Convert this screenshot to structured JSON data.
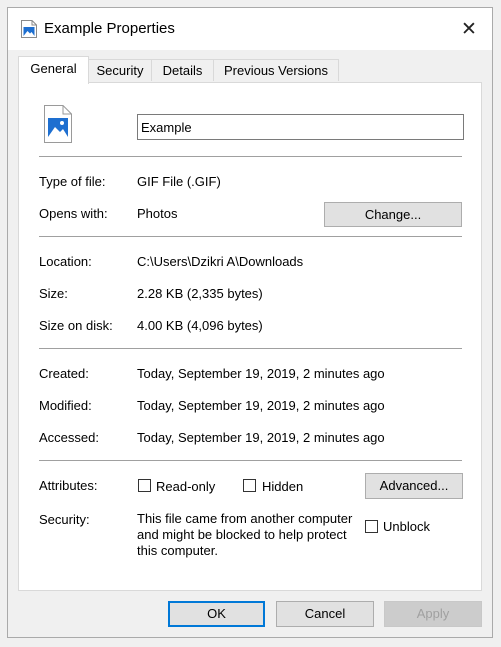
{
  "window": {
    "title": "Example Properties",
    "close_glyph": "✕"
  },
  "tabs": [
    {
      "label": "General",
      "active": true
    },
    {
      "label": "Security",
      "active": false
    },
    {
      "label": "Details",
      "active": false
    },
    {
      "label": "Previous Versions",
      "active": false
    }
  ],
  "file": {
    "icon": "image-file-icon",
    "name": "Example"
  },
  "type_of_file": {
    "label": "Type of file:",
    "value": "GIF File (.GIF)"
  },
  "opens_with": {
    "label": "Opens with:",
    "value": "Photos",
    "button": "Change..."
  },
  "location": {
    "label": "Location:",
    "value": "C:\\Users\\Dzikri A\\Downloads"
  },
  "size": {
    "label": "Size:",
    "value": "2.28 KB (2,335 bytes)"
  },
  "size_on_disk": {
    "label": "Size on disk:",
    "value": "4.00 KB (4,096 bytes)"
  },
  "created": {
    "label": "Created:",
    "value": "Today, September 19, 2019, 2 minutes ago"
  },
  "modified": {
    "label": "Modified:",
    "value": "Today, September 19, 2019, 2 minutes ago"
  },
  "accessed": {
    "label": "Accessed:",
    "value": "Today, September 19, 2019, 2 minutes ago"
  },
  "attributes": {
    "label": "Attributes:",
    "read_only": {
      "label": "Read-only",
      "checked": false
    },
    "hidden": {
      "label": "Hidden",
      "checked": false
    },
    "advanced_button": "Advanced..."
  },
  "security": {
    "label": "Security:",
    "text": "This file came from another computer and might be blocked to help protect this computer.",
    "unblock": {
      "label": "Unblock",
      "checked": false
    }
  },
  "footer": {
    "ok": "OK",
    "cancel": "Cancel",
    "apply": "Apply"
  },
  "colors": {
    "accent": "#0078d7",
    "icon_blue": "#1e6fd0"
  }
}
